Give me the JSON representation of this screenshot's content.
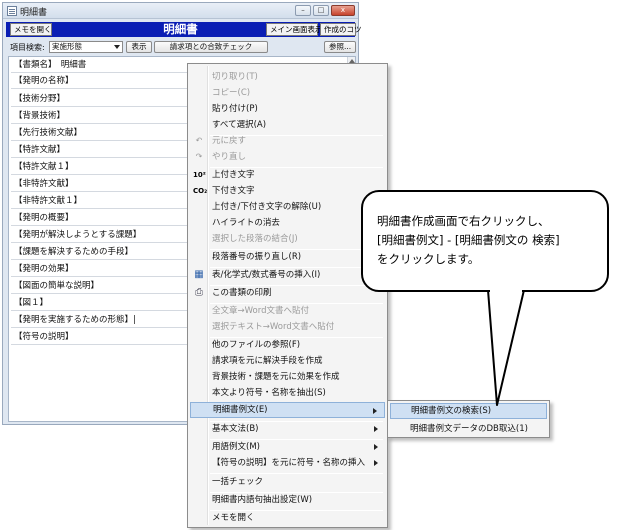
{
  "window": {
    "title": "明細書",
    "controls": {
      "minimize": "–",
      "maximize": "□",
      "close": "x"
    }
  },
  "header": {
    "memo_button": "メモを開く",
    "title": "明細書",
    "main_display_button": "メイン画面表示",
    "copy_button": "作成のコツ"
  },
  "toolbar": {
    "search_label": "項目検索:",
    "search_select_value": "実施形態",
    "display_button": "表示",
    "claims_check_button": "請求項との合致チェック",
    "reference_button": "参照..."
  },
  "editor_lines": [
    "【書類名】　明細書",
    "【発明の名称】",
    "【技術分野】",
    "【背景技術】",
    "【先行技術文献】",
    "【特許文献】",
    "【特許文献１】",
    "【非特許文献】",
    "【非特許文献１】",
    "【発明の概要】",
    "【発明が解決しようとする課題】",
    "【課題を解決するための手段】",
    "【発明の効果】",
    "【図面の簡単な説明】",
    "【図１】",
    "【発明を実施するための形態】|",
    "【符号の説明】"
  ],
  "context_menu": {
    "cut": "切り取り(T)",
    "copy": "コピー(C)",
    "paste": "貼り付け(P)",
    "select_all": "すべて選択(A)",
    "undo": "元に戻す",
    "redo": "やり直し",
    "superscript": "上付き文字",
    "subscript": "下付き文字",
    "clear_sup_sub": "上付き/下付き文字の解除(U)",
    "clear_highlight": "ハイライトの消去",
    "merge_paragraphs": "選択した段落の結合(J)",
    "renumber_paragraphs": "段落番号の振り直し(R)",
    "insert_table": "表/化学式/数式番号の挿入(I)",
    "print": "この書類の印刷",
    "all_to_word": "全文章→Word文書へ貼付",
    "selection_to_word": "選択テキスト→Word文書へ貼付",
    "reference_other_file": "他のファイルの参照(F)",
    "create_means_from_claims": "請求項を元に解決手段を作成",
    "create_effect": "背景技術・課題を元に効果を作成",
    "extract_symbols": "本文より符号・名称を抽出(S)",
    "spec_examples": "明細書例文(E)",
    "basic_grammar": "基本文法(B)",
    "term_examples": "用語例文(M)",
    "insert_symbols": "【符号の説明】を元に符号・名称の挿入",
    "bulk_check": "一括チェック",
    "term_extract_settings": "明細書内語句抽出設定(W)",
    "open_memo": "メモを開く"
  },
  "submenu": {
    "search_examples": "明細書例文の検索(S)",
    "import_examples_db": "明細書例文データのDB取込(1)"
  },
  "callout": {
    "line1": "明細書作成画面で右クリックし、",
    "line2": "[明細書例文] - [明細書例文の 検索]",
    "line3": "をクリックします。"
  },
  "icons": {
    "superscript_glyph": "10²",
    "subscript_glyph": "CO₂",
    "undo_glyph": "↶",
    "redo_glyph": "↷",
    "table_glyph": "▦",
    "printer_glyph": "⎙"
  },
  "colors": {
    "title_band": "#0a1eb4",
    "menu_highlight": "#cfe0f3",
    "window_bg": "#dfe7f1"
  }
}
